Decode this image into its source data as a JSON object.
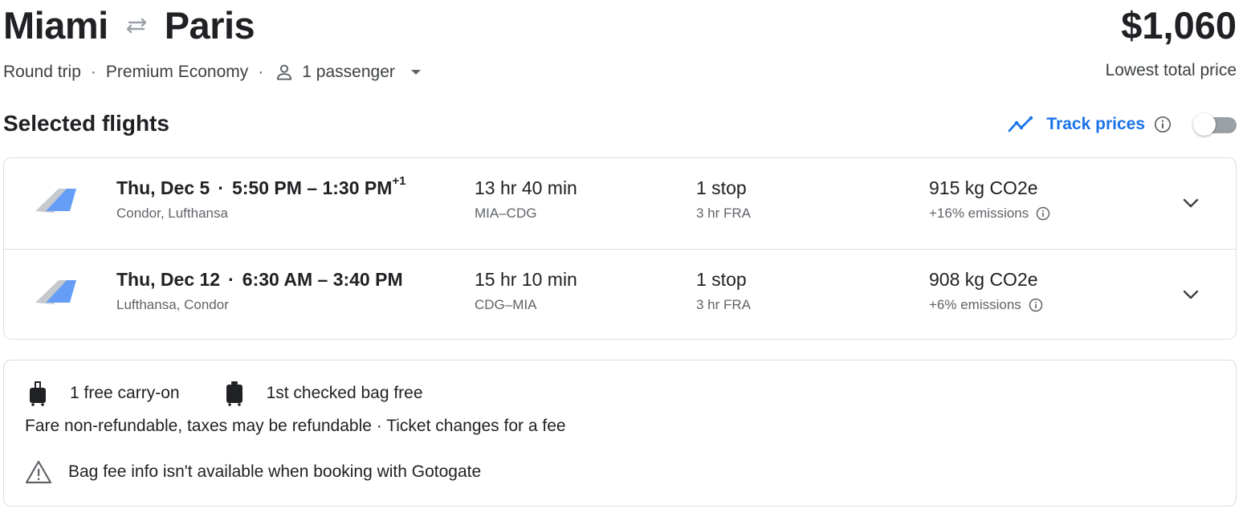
{
  "header": {
    "origin": "Miami",
    "destination": "Paris",
    "price": "$1,060",
    "price_caption": "Lowest total price"
  },
  "trip": {
    "type": "Round trip",
    "cabin": "Premium Economy",
    "passengers": "1 passenger"
  },
  "selected": {
    "title": "Selected flights",
    "track_label": "Track prices",
    "track_enabled": false
  },
  "flights": [
    {
      "date": "Thu, Dec 5",
      "times": "5:50 PM – 1:30 PM",
      "day_offset": "+1",
      "airlines": "Condor, Lufthansa",
      "duration": "13 hr 40 min",
      "route": "MIA–CDG",
      "stops": "1 stop",
      "layover": "3 hr FRA",
      "emissions": "915 kg CO2e",
      "emissions_delta": "+16% emissions"
    },
    {
      "date": "Thu, Dec 12",
      "times": "6:30 AM – 3:40 PM",
      "day_offset": "",
      "airlines": "Lufthansa, Condor",
      "duration": "15 hr 10 min",
      "route": "CDG–MIA",
      "stops": "1 stop",
      "layover": "3 hr FRA",
      "emissions": "908 kg CO2e",
      "emissions_delta": "+6% emissions"
    }
  ],
  "fare": {
    "carry_on": "1 free carry-on",
    "checked": "1st checked bag free",
    "policy": "Fare non-refundable, taxes may be refundable · Ticket changes for a fee",
    "warning": "Bag fee info isn't available when booking with Gotogate"
  },
  "icons": {
    "swap": "swap-arrows-icon",
    "person": "person-icon",
    "dropdown": "caret-down-icon",
    "track": "trend-line-icon",
    "info": "info-icon",
    "airline_tail": "airline-tail-icon",
    "expand": "chevron-down-icon",
    "carry_on": "carry-on-bag-icon",
    "checked_bag": "checked-bag-icon",
    "warning": "warning-icon"
  },
  "colors": {
    "accent": "#1a73e8",
    "text": "#202124",
    "secondary": "#5f6368",
    "border": "#dadce0"
  }
}
